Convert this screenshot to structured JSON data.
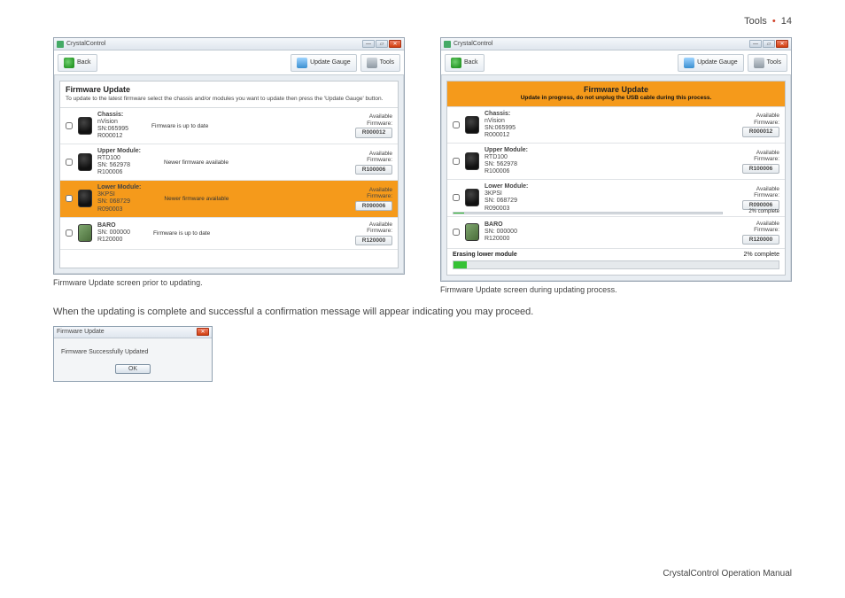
{
  "header": {
    "section": "Tools",
    "page": "14"
  },
  "app": {
    "title": "CrystalControl",
    "back": "Back",
    "update_gauge": "Update Gauge",
    "tools": "Tools"
  },
  "winA": {
    "heading": "Firmware Update",
    "sub": "To update to the latest firmware select the chassis and/or modules you want to update then press the 'Update Gauge' button.",
    "rows": [
      {
        "name": "Chassis:",
        "l2": "nVision",
        "l3": "SN:065995",
        "l4": "R000012",
        "mid": "Firmware is up to date",
        "avail": "Available",
        "fwlbl": "Firmware:",
        "fw": "R000012",
        "hl": false,
        "alt": false
      },
      {
        "name": "Upper Module:",
        "l2": "RTD100",
        "l3": "SN: 562978",
        "l4": "R100006",
        "mid": "Newer firmware available",
        "avail": "Available",
        "fwlbl": "Firmware:",
        "fw": "R100006",
        "hl": false,
        "alt": false
      },
      {
        "name": "Lower Module:",
        "l2": "3KPSI",
        "l3": "SN: 068729",
        "l4": "R090003",
        "mid": "Newer firmware available",
        "avail": "Available",
        "fwlbl": "Firmware:",
        "fw": "R090006",
        "hl": true,
        "alt": false
      },
      {
        "name": "BARO",
        "l2": "SN: 000000",
        "l3": "R120000",
        "l4": "",
        "mid": "Firmware is up to date",
        "avail": "Available",
        "fwlbl": "Firmware:",
        "fw": "R120000",
        "hl": false,
        "alt": true
      }
    ]
  },
  "winB": {
    "heading": "Firmware Update",
    "sub": "Update in progress, do not unplug the USB cable during this process.",
    "rows": [
      {
        "name": "Chassis:",
        "l2": "nVision",
        "l3": "SN:065995",
        "l4": "R000012",
        "avail": "Available",
        "fwlbl": "Firmware:",
        "fw": "R000012",
        "alt": false,
        "pct": ""
      },
      {
        "name": "Upper Module:",
        "l2": "RTD100",
        "l3": "SN: 562978",
        "l4": "R100006",
        "avail": "Available",
        "fwlbl": "Firmware:",
        "fw": "R100006",
        "alt": false,
        "pct": ""
      },
      {
        "name": "Lower Module:",
        "l2": "3KPSI",
        "l3": "SN: 068729",
        "l4": "R090003",
        "avail": "Available",
        "fwlbl": "Firmware:",
        "fw": "R090006",
        "alt": false,
        "pct": "2% complete"
      },
      {
        "name": "BARO",
        "l2": "SN: 000000",
        "l3": "R120000",
        "l4": "",
        "avail": "Available",
        "fwlbl": "Firmware:",
        "fw": "R120000",
        "alt": true,
        "pct": ""
      }
    ],
    "footer_msg": "Erasing lower module",
    "footer_pct": "2% complete"
  },
  "captions": {
    "a": "Firmware Update screen prior to updating.",
    "b": "Firmware Update screen during updating process."
  },
  "body_text": "When the updating is complete and successful a confirmation message will appear indicating you may proceed.",
  "dialog": {
    "title": "Firmware Update",
    "msg": "Firmware Successfully Updated",
    "ok": "OK"
  },
  "footer": "CrystalControl Operation Manual"
}
